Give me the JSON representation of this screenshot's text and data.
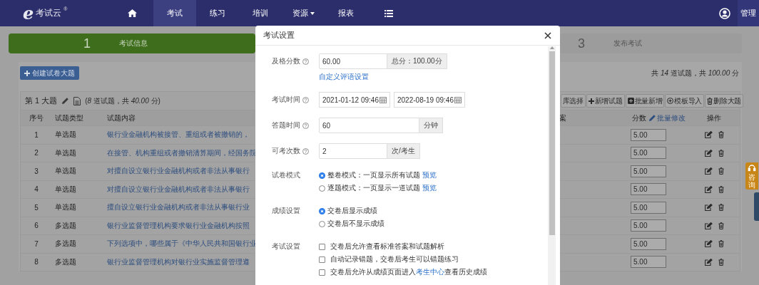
{
  "nav": {
    "logo": {
      "mark": "e",
      "name": "考试云",
      "trademark": "®"
    },
    "items": [
      {
        "kind": "home",
        "selected": false
      },
      {
        "kind": "text",
        "label": "考试",
        "selected": true
      },
      {
        "kind": "text",
        "label": "练习",
        "selected": false
      },
      {
        "kind": "text",
        "label": "培训",
        "selected": false
      },
      {
        "kind": "dropdown",
        "label": "资源",
        "selected": false
      },
      {
        "kind": "text",
        "label": "报表",
        "selected": false
      },
      {
        "kind": "list",
        "selected": false
      }
    ],
    "user": "管理"
  },
  "steps": [
    {
      "number": "1",
      "label": "考试信息",
      "active": true
    },
    {
      "number": "3",
      "label": "发布考试",
      "active": false
    }
  ],
  "create_button": "创建试卷大题",
  "summary": "共 *14* 道试题，共 *100.00* 分",
  "section": {
    "title": "第 1 大题",
    "summary": "(*8* 道试题，共 *40.00* 分)",
    "toolbar": [
      {
        "label": "库选择",
        "kind": "plain"
      },
      {
        "label": "新增试题",
        "kind": "add"
      },
      {
        "label": "批量新增",
        "kind": "batch"
      },
      {
        "label": "模板导入",
        "kind": "import"
      },
      {
        "label": "删除大题",
        "kind": "delete"
      }
    ],
    "columns": [
      "序号",
      "试题类型",
      "试题内容",
      "案",
      "分数",
      "操作"
    ],
    "batch_edit": "批量修改",
    "rows": [
      {
        "number": "1",
        "type": "单选题",
        "content": "银行业金融机构被接管、重组或者被撤销的，",
        "score": "5.00"
      },
      {
        "number": "2",
        "type": "单选题",
        "content": "在接管、机构重组或者撤销清算期间，经国务院",
        "score": "5.00"
      },
      {
        "number": "3",
        "type": "单选题",
        "content": "对擅自设立银行业金融机构或者非法从事银行",
        "score": "5.00"
      },
      {
        "number": "4",
        "type": "单选题",
        "content": "对擅自设立银行业金融机构或者非法从事银行",
        "score": "5.00"
      },
      {
        "number": "5",
        "type": "单选题",
        "content": "擅自设立银行业金融机构或者非法从事银行业",
        "score": "5.00"
      },
      {
        "number": "6",
        "type": "多选题",
        "content": "银行业监督管理机构要求银行业金融机构按照",
        "score": "5.00"
      },
      {
        "number": "7",
        "type": "多选题",
        "content": "下列选项中，哪些属于《中华人民共和国银行业",
        "score": "5.00"
      },
      {
        "number": "8",
        "type": "多选题",
        "content": "银行业监督管理机构对银行业实施监督管理遵",
        "score": "5.00"
      }
    ]
  },
  "side_tab": "咨询",
  "modal": {
    "title": "考试设置",
    "fields": [
      {
        "kind": "addon",
        "label": "及格分数",
        "help": true,
        "value": "60.00",
        "addon": "总分：100.00分",
        "link": "自定义评语设置"
      },
      {
        "kind": "daterange",
        "label": "考试时间",
        "help": true,
        "start": "2021-01-12 09:46",
        "end": "2022-08-19 09:46"
      },
      {
        "kind": "addon",
        "label": "答题时间",
        "help": true,
        "value": "60",
        "addon": "分钟"
      },
      {
        "kind": "addon",
        "label": "可考次数",
        "help": true,
        "value": "2",
        "addon": "次/考生"
      },
      {
        "kind": "radio",
        "label": "试卷模式",
        "options": [
          {
            "text": "整卷模式：一页显示所有试题",
            "link": "预览",
            "selected": true
          },
          {
            "text": "逐题模式：一页显示一道试题",
            "link": "预览",
            "selected": false
          }
        ]
      },
      {
        "kind": "radio",
        "label": "成绩设置",
        "options": [
          {
            "text": "交卷后显示成绩",
            "selected": true
          },
          {
            "text": "交卷后不显示成绩",
            "selected": false
          }
        ]
      },
      {
        "kind": "checkbox",
        "label": "考试设置",
        "options": [
          {
            "text": "交卷后允许查看标准答案和试题解析",
            "checked": false
          },
          {
            "text": "自动记录错题，交卷后考生可以错题练习",
            "checked": false
          },
          {
            "text": "交卷后允许从成绩页面进入",
            "link": "考生中心",
            "after": "查看历史成绩",
            "checked": false
          }
        ]
      }
    ]
  }
}
